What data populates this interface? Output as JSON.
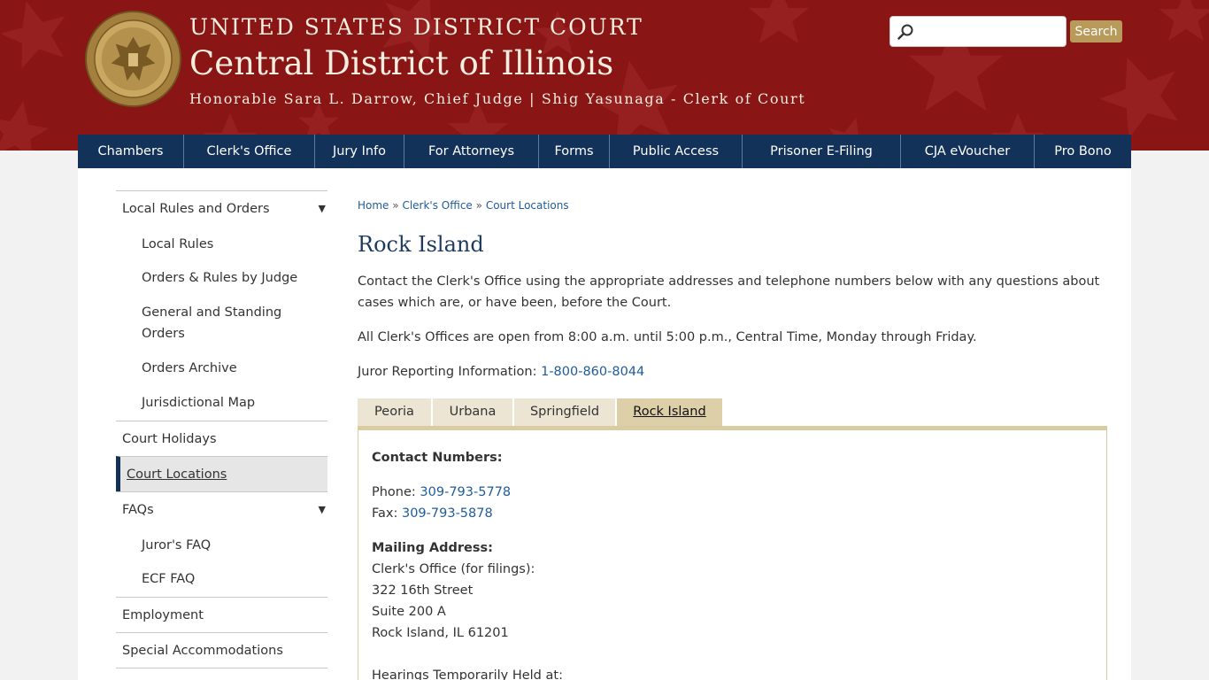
{
  "header": {
    "court_line": "UNITED STATES DISTRICT COURT",
    "district": "Central District of Illinois",
    "judges": "Honorable Sara L. Darrow, Chief Judge | Shig Yasunaga - Clerk of Court",
    "search_placeholder": "",
    "search_button": "Search",
    "colors": {
      "banner": "#8a1515",
      "nav": "#13325a",
      "accent": "#b89a5a"
    }
  },
  "nav": {
    "items": [
      "Chambers",
      "Clerk's Office",
      "Jury Info",
      "For Attorneys",
      "Forms",
      "Public Access",
      "Prisoner E-Filing",
      "CJA eVoucher",
      "Pro Bono"
    ]
  },
  "sidebar": {
    "local_rules": "Local Rules and Orders",
    "local_rules_sub": [
      "Local Rules",
      "Orders & Rules by Judge",
      "General and Standing Orders",
      "Orders Archive",
      "Jurisdictional Map"
    ],
    "court_holidays": "Court Holidays",
    "court_locations": "Court Locations",
    "faqs": "FAQs",
    "faqs_sub": [
      "Juror's FAQ",
      "ECF FAQ"
    ],
    "employment": "Employment",
    "special": "Special Accommodations Notice"
  },
  "breadcrumb": {
    "home": "Home",
    "clerks_office": "Clerk's Office",
    "court_locations": "Court Locations",
    "sep": "»"
  },
  "page": {
    "title": "Rock Island",
    "intro": "Contact the Clerk's Office using the appropriate addresses and telephone numbers below with any questions about cases which are, or have been, before the Court.",
    "hours": "All Clerk's Offices are open from 8:00 a.m. until 5:00 p.m., Central Time, Monday through Friday.",
    "juror_label": "Juror Reporting Information:",
    "juror_phone": "1-800-860-8044"
  },
  "tabs": {
    "items": [
      "Peoria",
      "Urbana",
      "Springfield",
      "Rock Island"
    ],
    "active": "Rock Island"
  },
  "panel": {
    "contact_heading": "Contact Numbers:",
    "phone_label": "Phone:",
    "phone": "309-793-5778",
    "fax_label": "Fax:",
    "fax": "309-793-5878",
    "mailing_heading": "Mailing Address:",
    "mailing_lines": [
      "Clerk's Office (for filings):",
      "322 16th Street",
      "Suite 200 A",
      "Rock Island, IL 61201"
    ],
    "hearings": "Hearings Temporarily Held at:"
  }
}
